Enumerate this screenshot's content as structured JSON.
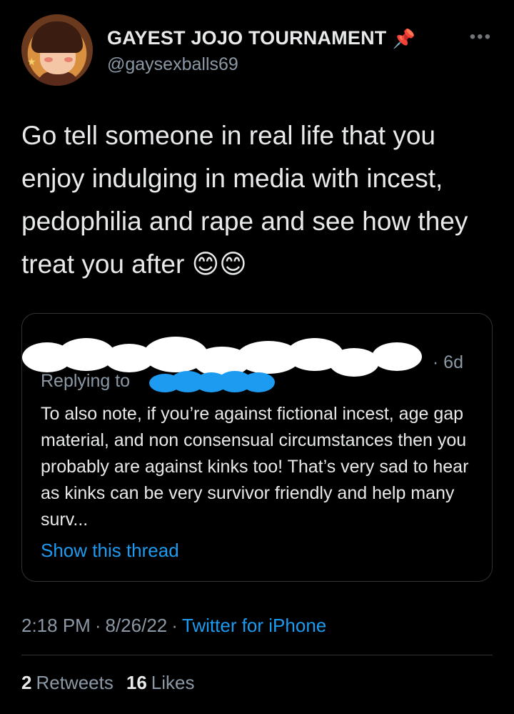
{
  "profile": {
    "display_name": "GAYEST JOJO TOURNAMENT",
    "pin_emoji": "📌",
    "handle": "@gaysexballs69",
    "more_icon": "more-horizontal-icon"
  },
  "tweet": {
    "text": "Go tell someone in real life that you enjoy indulging in media with incest, pedophilia and rape and see how they treat you after 😊😊"
  },
  "quote": {
    "age": "· 6d",
    "replying_label": "Replying to",
    "body": "To also note, if you’re against fictional incest, age gap material, and non consensual circumstances then you probably are against kinks too! That’s very sad to hear as kinks can be very survivor friendly and help many surv...",
    "show_thread": "Show this thread"
  },
  "meta": {
    "time": "2:18 PM",
    "sep1": "·",
    "date": "8/26/22",
    "sep2": "·",
    "source": "Twitter for iPhone"
  },
  "stats": {
    "retweets_count": "2",
    "retweets_label": "Retweets",
    "likes_count": "16",
    "likes_label": "Likes"
  },
  "colors": {
    "background": "#000000",
    "text": "#e7e9ea",
    "secondary": "#8b98a5",
    "link": "#1d9bf0",
    "border": "#2f3336"
  }
}
